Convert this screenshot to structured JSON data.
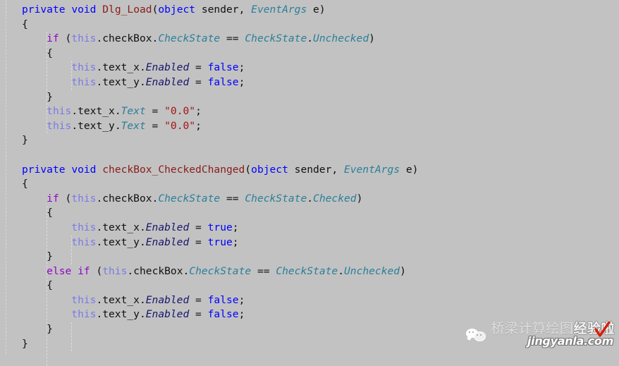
{
  "editor": {
    "background_color": "#c2c2c2",
    "language": "csharp",
    "colors": {
      "keyword": "#0000ff",
      "control_keyword": "#8f08c4",
      "this_keyword": "#7a7ae8",
      "method_name": "#8b1a1a",
      "type_name": "#2b7f99",
      "property_name": "#16166e",
      "string_literal": "#a31515",
      "plain_text": "#101010"
    },
    "lines": [
      {
        "indent": 0,
        "tokens": [
          {
            "t": "private",
            "c": "kw"
          },
          {
            "t": " ",
            "c": "pl"
          },
          {
            "t": "void",
            "c": "kw"
          },
          {
            "t": " ",
            "c": "pl"
          },
          {
            "t": "Dlg_Load",
            "c": "fn"
          },
          {
            "t": "(",
            "c": "pl"
          },
          {
            "t": "object",
            "c": "kw"
          },
          {
            "t": " sender, ",
            "c": "pl"
          },
          {
            "t": "EventArgs",
            "c": "type"
          },
          {
            "t": " e)",
            "c": "pl"
          }
        ]
      },
      {
        "indent": 0,
        "tokens": [
          {
            "t": "{",
            "c": "brace"
          }
        ]
      },
      {
        "indent": 1,
        "tokens": [
          {
            "t": "if",
            "c": "ctl"
          },
          {
            "t": " (",
            "c": "pl"
          },
          {
            "t": "this",
            "c": "this"
          },
          {
            "t": ".checkBox.",
            "c": "pl"
          },
          {
            "t": "CheckState",
            "c": "type"
          },
          {
            "t": " == ",
            "c": "pl"
          },
          {
            "t": "CheckState",
            "c": "type"
          },
          {
            "t": ".",
            "c": "pl"
          },
          {
            "t": "Unchecked",
            "c": "type"
          },
          {
            "t": ")",
            "c": "pl"
          }
        ]
      },
      {
        "indent": 1,
        "tokens": [
          {
            "t": "{",
            "c": "brace"
          }
        ]
      },
      {
        "indent": 2,
        "tokens": [
          {
            "t": "this",
            "c": "this"
          },
          {
            "t": ".text_x.",
            "c": "pl"
          },
          {
            "t": "Enabled",
            "c": "prop"
          },
          {
            "t": " = ",
            "c": "pl"
          },
          {
            "t": "false",
            "c": "kw"
          },
          {
            "t": ";",
            "c": "pl"
          }
        ]
      },
      {
        "indent": 2,
        "tokens": [
          {
            "t": "this",
            "c": "this"
          },
          {
            "t": ".text_y.",
            "c": "pl"
          },
          {
            "t": "Enabled",
            "c": "prop"
          },
          {
            "t": " = ",
            "c": "pl"
          },
          {
            "t": "false",
            "c": "kw"
          },
          {
            "t": ";",
            "c": "pl"
          }
        ]
      },
      {
        "indent": 1,
        "tokens": [
          {
            "t": "}",
            "c": "brace"
          }
        ]
      },
      {
        "indent": 1,
        "tokens": [
          {
            "t": "this",
            "c": "this"
          },
          {
            "t": ".text_x.",
            "c": "pl"
          },
          {
            "t": "Text",
            "c": "propt"
          },
          {
            "t": " = ",
            "c": "pl"
          },
          {
            "t": "\"0.0\"",
            "c": "str"
          },
          {
            "t": ";",
            "c": "pl"
          }
        ]
      },
      {
        "indent": 1,
        "tokens": [
          {
            "t": "this",
            "c": "this"
          },
          {
            "t": ".text_y.",
            "c": "pl"
          },
          {
            "t": "Text",
            "c": "propt"
          },
          {
            "t": " = ",
            "c": "pl"
          },
          {
            "t": "\"0.0\"",
            "c": "str"
          },
          {
            "t": ";",
            "c": "pl"
          }
        ]
      },
      {
        "indent": 0,
        "tokens": [
          {
            "t": "}",
            "c": "brace"
          }
        ]
      },
      {
        "indent": 0,
        "tokens": [
          {
            "t": "",
            "c": "pl"
          }
        ]
      },
      {
        "indent": 0,
        "tokens": [
          {
            "t": "private",
            "c": "kw"
          },
          {
            "t": " ",
            "c": "pl"
          },
          {
            "t": "void",
            "c": "kw"
          },
          {
            "t": " ",
            "c": "pl"
          },
          {
            "t": "checkBox_CheckedChanged",
            "c": "fn"
          },
          {
            "t": "(",
            "c": "pl"
          },
          {
            "t": "object",
            "c": "kw"
          },
          {
            "t": " sender, ",
            "c": "pl"
          },
          {
            "t": "EventArgs",
            "c": "type"
          },
          {
            "t": " e)",
            "c": "pl"
          }
        ]
      },
      {
        "indent": 0,
        "tokens": [
          {
            "t": "{",
            "c": "brace"
          }
        ]
      },
      {
        "indent": 1,
        "tokens": [
          {
            "t": "if",
            "c": "ctl"
          },
          {
            "t": " (",
            "c": "pl"
          },
          {
            "t": "this",
            "c": "this"
          },
          {
            "t": ".checkBox.",
            "c": "pl"
          },
          {
            "t": "CheckState",
            "c": "type"
          },
          {
            "t": " == ",
            "c": "pl"
          },
          {
            "t": "CheckState",
            "c": "type"
          },
          {
            "t": ".",
            "c": "pl"
          },
          {
            "t": "Checked",
            "c": "type"
          },
          {
            "t": ")",
            "c": "pl"
          }
        ]
      },
      {
        "indent": 1,
        "tokens": [
          {
            "t": "{",
            "c": "brace"
          }
        ]
      },
      {
        "indent": 2,
        "tokens": [
          {
            "t": "this",
            "c": "this"
          },
          {
            "t": ".text_x.",
            "c": "pl"
          },
          {
            "t": "Enabled",
            "c": "prop"
          },
          {
            "t": " = ",
            "c": "pl"
          },
          {
            "t": "true",
            "c": "kw"
          },
          {
            "t": ";",
            "c": "pl"
          }
        ]
      },
      {
        "indent": 2,
        "tokens": [
          {
            "t": "this",
            "c": "this"
          },
          {
            "t": ".text_y.",
            "c": "pl"
          },
          {
            "t": "Enabled",
            "c": "prop"
          },
          {
            "t": " = ",
            "c": "pl"
          },
          {
            "t": "true",
            "c": "kw"
          },
          {
            "t": ";",
            "c": "pl"
          }
        ]
      },
      {
        "indent": 1,
        "tokens": [
          {
            "t": "}",
            "c": "brace"
          }
        ]
      },
      {
        "indent": 1,
        "tokens": [
          {
            "t": "else",
            "c": "ctl"
          },
          {
            "t": " ",
            "c": "pl"
          },
          {
            "t": "if",
            "c": "ctl"
          },
          {
            "t": " (",
            "c": "pl"
          },
          {
            "t": "this",
            "c": "this"
          },
          {
            "t": ".checkBox.",
            "c": "pl"
          },
          {
            "t": "CheckState",
            "c": "type"
          },
          {
            "t": " == ",
            "c": "pl"
          },
          {
            "t": "CheckState",
            "c": "type"
          },
          {
            "t": ".",
            "c": "pl"
          },
          {
            "t": "Unchecked",
            "c": "type"
          },
          {
            "t": ")",
            "c": "pl"
          }
        ]
      },
      {
        "indent": 1,
        "tokens": [
          {
            "t": "{",
            "c": "brace"
          }
        ]
      },
      {
        "indent": 2,
        "tokens": [
          {
            "t": "this",
            "c": "this"
          },
          {
            "t": ".text_x.",
            "c": "pl"
          },
          {
            "t": "Enabled",
            "c": "prop"
          },
          {
            "t": " = ",
            "c": "pl"
          },
          {
            "t": "false",
            "c": "kw"
          },
          {
            "t": ";",
            "c": "pl"
          }
        ]
      },
      {
        "indent": 2,
        "tokens": [
          {
            "t": "this",
            "c": "this"
          },
          {
            "t": ".text_y.",
            "c": "pl"
          },
          {
            "t": "Enabled",
            "c": "prop"
          },
          {
            "t": " = ",
            "c": "pl"
          },
          {
            "t": "false",
            "c": "kw"
          },
          {
            "t": ";",
            "c": "pl"
          }
        ]
      },
      {
        "indent": 1,
        "tokens": [
          {
            "t": "}",
            "c": "brace"
          }
        ]
      },
      {
        "indent": 0,
        "tokens": [
          {
            "t": "}",
            "c": "brace"
          }
        ]
      }
    ]
  },
  "watermark": {
    "chat_icon": "wechat-bubbles-icon",
    "text_normal": "桥梁计算绘图",
    "text_strong": "经验啦",
    "url": "jingyanla.com",
    "check_icon": "red-check-icon",
    "check_color": "#d81e06"
  }
}
